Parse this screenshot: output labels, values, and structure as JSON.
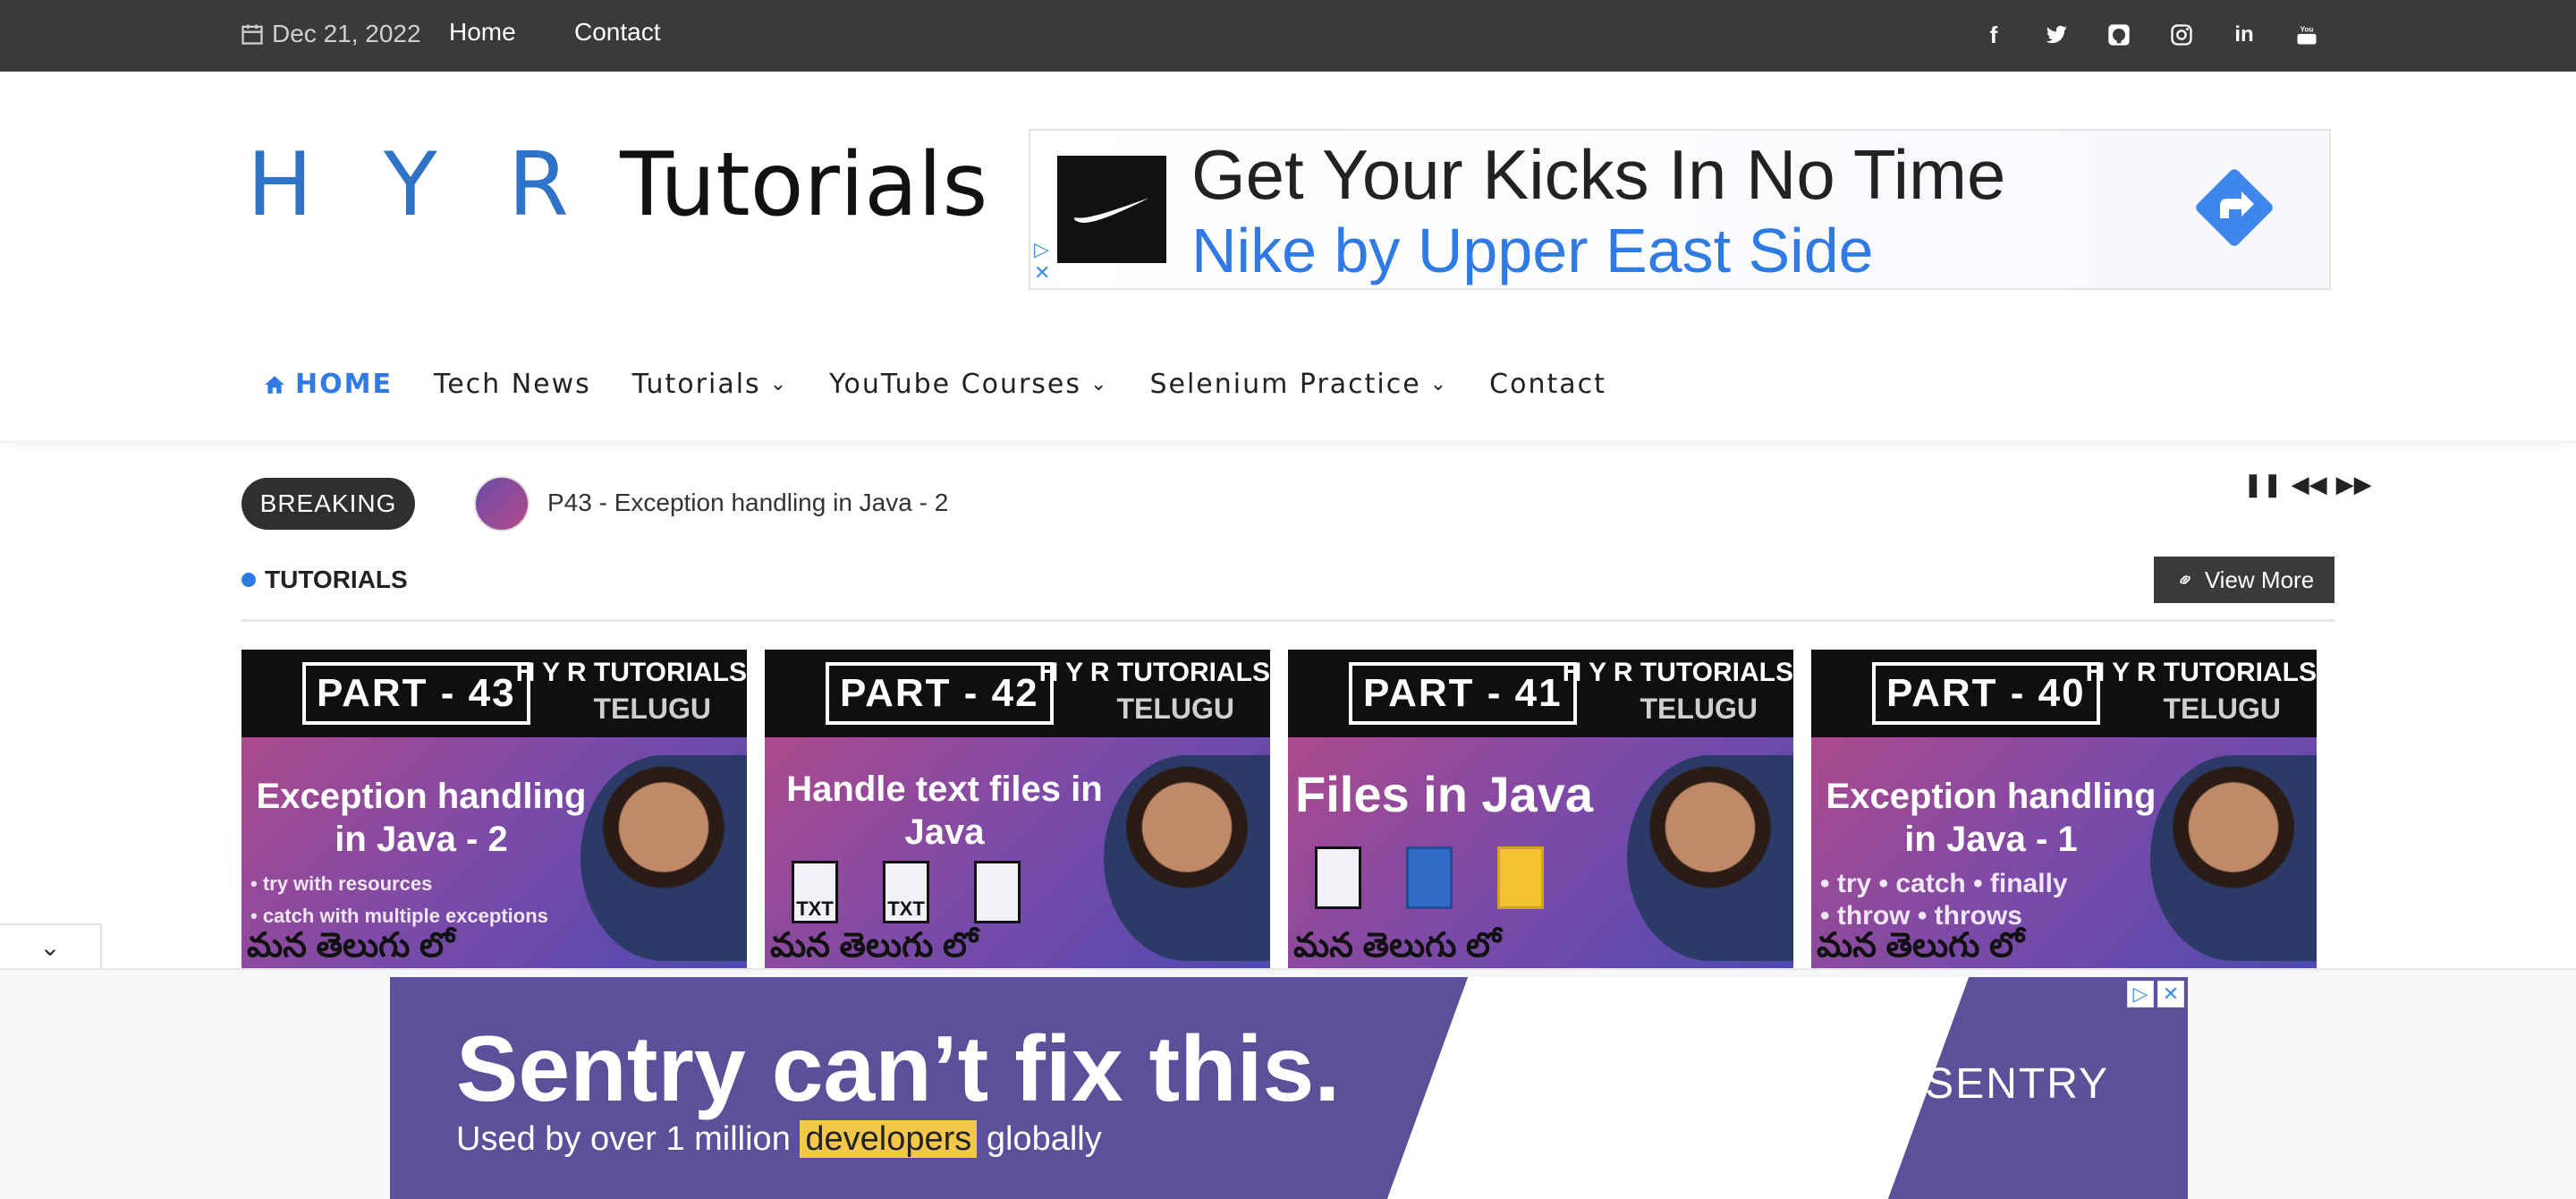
{
  "topbar": {
    "date": "Dec 21, 2022",
    "links": [
      "Home",
      "Contact"
    ],
    "social_icons": [
      "facebook-icon",
      "twitter-icon",
      "github-icon",
      "instagram-icon",
      "linkedin-icon",
      "youtube-icon"
    ]
  },
  "header": {
    "logo_hyr": "H Y R",
    "logo_tutorials": "Tutorials",
    "ad": {
      "headline": "Get Your Kicks In No Time",
      "subline": "Nike by Upper East Side"
    }
  },
  "nav": {
    "items": [
      {
        "label": "HOME"
      },
      {
        "label": "Tech News"
      },
      {
        "label": "Tutorials"
      },
      {
        "label": "YouTube Courses"
      },
      {
        "label": "Selenium Practice"
      },
      {
        "label": "Contact"
      }
    ]
  },
  "breaking": {
    "label": "BREAKING",
    "headline": "P43 - Exception handling in Java - 2"
  },
  "section": {
    "title": "TUTORIALS",
    "view_more": "View More"
  },
  "cards": [
    {
      "part": "PART - 43",
      "brand": "H Y R TUTORIALS",
      "lang": "TELUGU",
      "topic": "Exception handling in Java - 2",
      "bullets": [
        "• try with resources",
        "• catch with multiple exceptions"
      ],
      "telugu": "మన తెలుగు లో"
    },
    {
      "part": "PART - 42",
      "brand": "H Y R TUTORIALS",
      "lang": "TELUGU",
      "topic": "Handle text files in Java",
      "files": [
        "TXT",
        "TXT",
        ""
      ],
      "telugu": "మన తెలుగు లో"
    },
    {
      "part": "PART - 41",
      "brand": "H Y R TUTORIALS",
      "lang": "TELUGU",
      "topic": "Files in Java",
      "telugu": "మన తెలుగు లో"
    },
    {
      "part": "PART - 40",
      "brand": "H Y R TUTORIALS",
      "lang": "TELUGU",
      "topic": "Exception handling in Java - 1",
      "bullets": [
        "• try  • catch  • finally",
        "• throw • throws"
      ],
      "telugu": "మన తెలుగు లో"
    }
  ],
  "bottom_ad": {
    "headline": "Sentry can’t fix this.",
    "sub_before": "Used by over 1 million",
    "sub_highlight": "developers",
    "sub_after": "globally",
    "brand": "SENTRY"
  },
  "colors": {
    "accent": "#2f7ae5",
    "topbar": "#3a3a3a",
    "ad_purple": "#5d4f99",
    "highlight": "#f3c74a"
  }
}
